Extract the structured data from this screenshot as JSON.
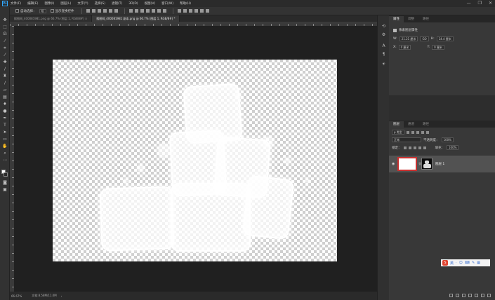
{
  "app": {
    "logo": "Ps"
  },
  "menu": [
    "文件(F)",
    "编辑(E)",
    "图像(I)",
    "图层(L)",
    "文字(Y)",
    "选择(S)",
    "滤镜(T)",
    "3D(D)",
    "视图(V)",
    "窗口(W)",
    "帮助(H)"
  ],
  "window_controls": {
    "minimize": "—",
    "restore": "❐",
    "close": "✕"
  },
  "options": {
    "auto_select_label": "自动选择：",
    "auto_select_value": "组",
    "transform_label": "显示变换控件"
  },
  "tabs": [
    {
      "label": "搜图网_400081981.png @ 66.7% (图层 1, RGB/8#) ×",
      "active": false
    },
    {
      "label": "搜图网_400081981 副本.png @ 66.7% (图层 1, RGB/8#) *",
      "active": true
    }
  ],
  "status": {
    "zoom": "66.67%",
    "doc": "文档:8.58M/11.0M",
    "arrow": "›"
  },
  "right_panel": {
    "tabs": [
      "属性",
      "调整",
      "路径"
    ],
    "title": "像素图层属性",
    "width_label": "W:",
    "width_value": "21.21 厘米",
    "link": "GO",
    "height_label": "H:",
    "height_value": "14.4 厘米",
    "x_label": "X:",
    "x_value": "0 厘米",
    "y_label": "Y:",
    "y_value": "0 厘米"
  },
  "layers_panel": {
    "tabs": [
      "图层",
      "通道",
      "路径"
    ],
    "kind_label": "ρ 类型",
    "blend_mode": "正常",
    "opacity_label": "不透明度：",
    "opacity_value": "100%",
    "lock_label": "锁定：",
    "fill_label": "填充：",
    "fill_value": "100%",
    "layer_name": "图层 1"
  },
  "ime": {
    "logo": "S",
    "items": [
      "英",
      "·",
      "☺",
      "⌨",
      "✎",
      "▦"
    ]
  }
}
